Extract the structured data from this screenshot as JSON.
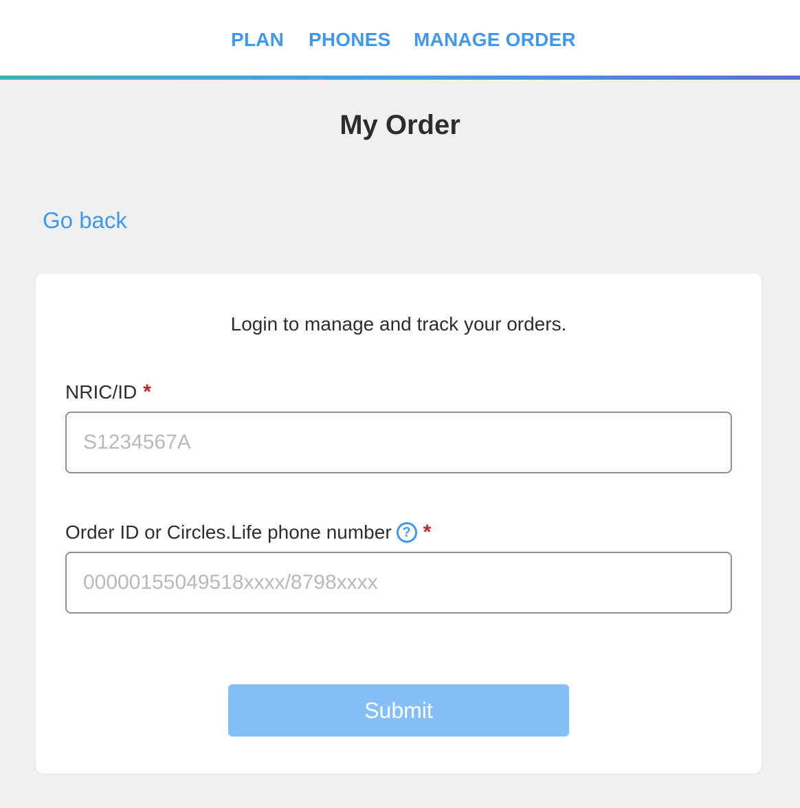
{
  "nav": {
    "items": [
      {
        "label": "PLAN"
      },
      {
        "label": "PHONES"
      },
      {
        "label": "MANAGE ORDER"
      }
    ],
    "gradient": [
      "#3fb0b4",
      "#4a9ee6",
      "#5b6fd6"
    ]
  },
  "page": {
    "title": "My Order",
    "back_label": "Go back"
  },
  "form": {
    "intro": "Login to manage and track your orders.",
    "nric": {
      "label": "NRIC/ID",
      "required_mark": "*",
      "placeholder": "S1234567A",
      "value": ""
    },
    "order": {
      "label": "Order ID or Circles.Life phone number",
      "help_icon": "question-circle-icon",
      "help_glyph": "?",
      "required_mark": "*",
      "placeholder": "00000155049518xxxx/8798xxxx",
      "value": ""
    },
    "submit_label": "Submit"
  },
  "colors": {
    "accent": "#3f98f0",
    "required": "#c0272d",
    "submit_disabled": "#84bff8",
    "background": "#f0f0f0"
  }
}
